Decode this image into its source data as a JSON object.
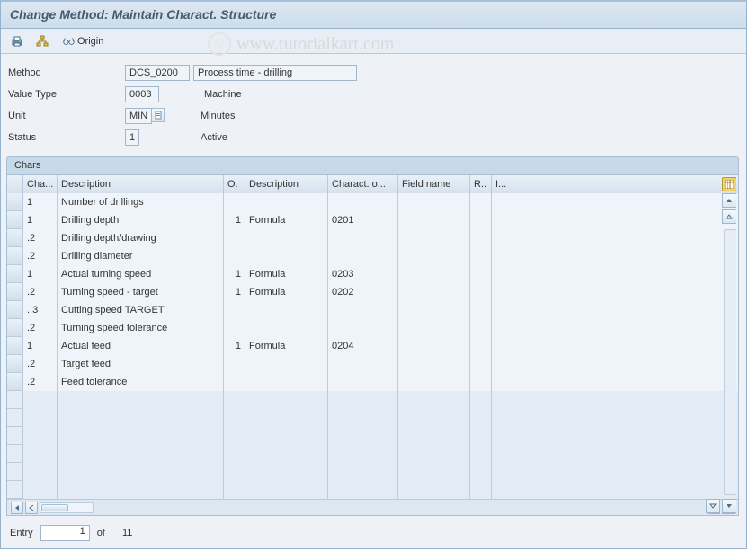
{
  "title": "Change Method: Maintain Charact. Structure",
  "watermark": "www.tutorialkart.com",
  "toolbar": {
    "origin_label": "Origin"
  },
  "form": {
    "method_label": "Method",
    "method_value": "DCS_0200",
    "method_desc": "Process time - drilling",
    "valuetype_label": "Value Type",
    "valuetype_value": "0003",
    "valuetype_desc": "Machine",
    "unit_label": "Unit",
    "unit_value": "MIN",
    "unit_desc": "Minutes",
    "status_label": "Status",
    "status_value": "1",
    "status_desc": "Active"
  },
  "panel_title": "Chars",
  "columns": {
    "cha": "Cha...",
    "desc": "Description",
    "o": "O.",
    "desc2": "Description",
    "char": "Charact. o...",
    "field": "Field name",
    "r": "R..",
    "i": "I..."
  },
  "rows": [
    {
      "cha": "1",
      "desc": "Number of drillings",
      "o": "",
      "desc2": "",
      "char": "",
      "field": ""
    },
    {
      "cha": "1",
      "desc": "Drilling depth",
      "o": "1",
      "desc2": "Formula",
      "char": "0201",
      "field": ""
    },
    {
      "cha": ".2",
      "desc": "Drilling depth/drawing",
      "o": "",
      "desc2": "",
      "char": "",
      "field": ""
    },
    {
      "cha": ".2",
      "desc": "Drilling diameter",
      "o": "",
      "desc2": "",
      "char": "",
      "field": ""
    },
    {
      "cha": "1",
      "desc": "Actual turning speed",
      "o": "1",
      "desc2": "Formula",
      "char": "0203",
      "field": ""
    },
    {
      "cha": ".2",
      "desc": "Turning speed - target",
      "o": "1",
      "desc2": "Formula",
      "char": "0202",
      "field": ""
    },
    {
      "cha": "..3",
      "desc": "Cutting speed TARGET",
      "o": "",
      "desc2": "",
      "char": "",
      "field": ""
    },
    {
      "cha": ".2",
      "desc": "Turning speed tolerance",
      "o": "",
      "desc2": "",
      "char": "",
      "field": ""
    },
    {
      "cha": "1",
      "desc": "Actual feed",
      "o": "1",
      "desc2": "Formula",
      "char": "0204",
      "field": ""
    },
    {
      "cha": ".2",
      "desc": "Target feed",
      "o": "",
      "desc2": "",
      "char": "",
      "field": ""
    },
    {
      "cha": ".2",
      "desc": "Feed tolerance",
      "o": "",
      "desc2": "",
      "char": "",
      "field": ""
    }
  ],
  "empty_rows": 6,
  "entry": {
    "label": "Entry",
    "value": "1",
    "of": "of",
    "total": "11"
  }
}
